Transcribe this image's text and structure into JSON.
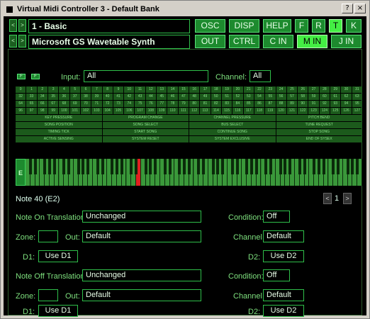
{
  "window": {
    "title": "Virtual Midi Controller 3 - Default Bank",
    "btn_question": "?",
    "btn_close": "×"
  },
  "header": {
    "bank_field": "1 - Basic",
    "device_field": "Microsoft GS Wavetable Synth",
    "nav_prev": "<",
    "nav_next": ">",
    "buttons_row1": [
      {
        "label": "OSC"
      },
      {
        "label": "DISP"
      },
      {
        "label": "HELP"
      },
      {
        "label": "F"
      },
      {
        "label": "R"
      },
      {
        "label": "T",
        "on": true
      },
      {
        "label": "K"
      }
    ],
    "buttons_row2": [
      {
        "label": "OUT"
      },
      {
        "label": "CTRL"
      },
      {
        "label": "C IN"
      },
      {
        "label": "M IN",
        "on": true
      },
      {
        "label": "J IN"
      }
    ]
  },
  "filter": {
    "mini1": "F",
    "mini2": "F",
    "input_label": "Input:",
    "input_value": "All",
    "channel_label": "Channel:",
    "channel_value": "All"
  },
  "cc_rows": 4,
  "cc_cols": 32,
  "status_buttons": [
    [
      "KEY PRESSURE",
      "PROGRAM CHANGE",
      "CHANNEL PRESSURE",
      "PITCH BEND"
    ],
    [
      "SONG POSITION",
      "SONG SELECT",
      "BUS SELECT",
      "TUNE REQUEST"
    ],
    [
      "TIMING TICK",
      "START SONG",
      "CONTINUE SONG",
      "STOP SONG"
    ],
    [
      "ACTIVE SENSING",
      "SYSTEM RESET",
      "SYSTEM EXCLUSIVE",
      "END OF SYSEX"
    ]
  ],
  "keyboard": {
    "label": "E",
    "white_keys": 70,
    "active_key": 23
  },
  "note": {
    "text": "Note 40 (E2)",
    "page": "1",
    "prev": "<",
    "next": ">"
  },
  "note_on": {
    "translation_label": "Note On Translation:",
    "translation_value": "Unchanged",
    "condition_label": "Condition:",
    "condition_value": "Off",
    "zone_label": "Zone:",
    "zone_value": "",
    "out_label": "Out:",
    "out_value": "Default",
    "channel_label": "Channel:",
    "channel_value": "Default",
    "d1_label": "D1:",
    "d1_value": "Use D1",
    "d2_label": "D2:",
    "d2_value": "Use D2"
  },
  "note_off": {
    "translation_label": "Note Off Translation:",
    "translation_value": "Unchanged",
    "condition_label": "Condition:",
    "condition_value": "Off",
    "zone_label": "Zone:",
    "zone_value": "",
    "out_label": "Out:",
    "out_value": "Default",
    "channel_label": "Channel:",
    "channel_value": "Default",
    "d1_label": "D1:",
    "d1_value": "Use D1",
    "d2_label": "D2:",
    "d2_value": "Use D2"
  }
}
